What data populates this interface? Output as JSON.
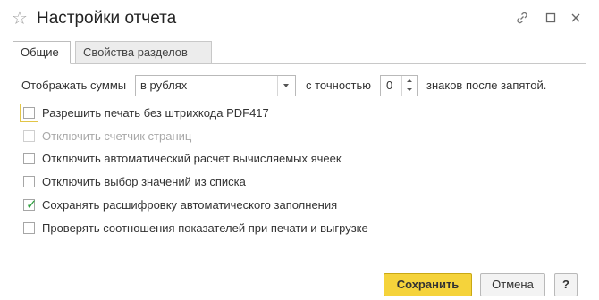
{
  "window": {
    "title": "Настройки отчета"
  },
  "tabs": [
    {
      "label": "Общие",
      "active": true
    },
    {
      "label": "Свойства разделов",
      "active": false
    }
  ],
  "display_row": {
    "label": "Отображать суммы",
    "select_value": "в рублях",
    "precision_label": "с точностью",
    "precision_value": "0",
    "suffix_label": "знаков после запятой."
  },
  "checkboxes": [
    {
      "label": "Разрешить печать без штрихкода PDF417",
      "checked": false,
      "disabled": false,
      "focused": true
    },
    {
      "label": "Отключить счетчик страниц",
      "checked": false,
      "disabled": true,
      "focused": false
    },
    {
      "label": "Отключить автоматический расчет вычисляемых ячеек",
      "checked": false,
      "disabled": false,
      "focused": false
    },
    {
      "label": "Отключить выбор значений из списка",
      "checked": false,
      "disabled": false,
      "focused": false
    },
    {
      "label": "Сохранять расшифровку автоматического заполнения",
      "checked": true,
      "disabled": false,
      "focused": false
    },
    {
      "label": "Проверять соотношения показателей при печати и выгрузке",
      "checked": false,
      "disabled": false,
      "focused": false
    }
  ],
  "buttons": {
    "save": "Сохранить",
    "cancel": "Отмена",
    "help": "?"
  },
  "colors": {
    "save_button": "#f5d33b",
    "check_mark": "#2e9e3e",
    "focus_ring": "#e2c547"
  }
}
